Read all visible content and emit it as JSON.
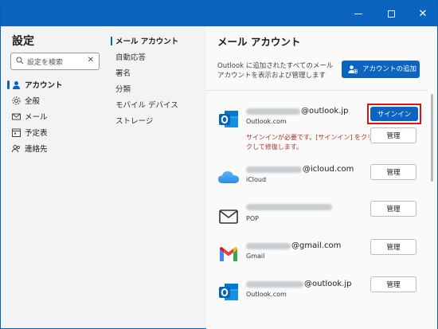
{
  "window": {
    "title_buttons": [
      "minimize",
      "maximize",
      "close"
    ]
  },
  "left": {
    "title": "設定",
    "search_placeholder": "設定を検索",
    "items": [
      {
        "label": "アカウント",
        "icon": "person-icon",
        "selected": true
      },
      {
        "label": "全般",
        "icon": "gear-icon",
        "selected": false
      },
      {
        "label": "メール",
        "icon": "mail-icon",
        "selected": false
      },
      {
        "label": "予定表",
        "icon": "calendar-icon",
        "selected": false
      },
      {
        "label": "連絡先",
        "icon": "people-icon",
        "selected": false
      }
    ]
  },
  "middle": {
    "items": [
      {
        "label": "メール アカウント",
        "selected": true
      },
      {
        "label": "自動応答",
        "selected": false
      },
      {
        "label": "署名",
        "selected": false
      },
      {
        "label": "分類",
        "selected": false
      },
      {
        "label": "モバイル デバイス",
        "selected": false
      },
      {
        "label": "ストレージ",
        "selected": false
      }
    ]
  },
  "right": {
    "title": "メール アカウント",
    "description": "Outlook に追加されたすべてのメール アカウントを表示および管理します",
    "add_account_label": "アカウントの追加",
    "sign_in_label": "サインイン",
    "manage_label": "管理",
    "error_text": "サインインが必要です。[サインイン] をクリックして修復します。",
    "accounts": [
      {
        "domain": "@outlook.jp",
        "provider": "Outlook.com",
        "logo": "outlook-logo"
      },
      {
        "domain": "@icloud.com",
        "provider": "iCloud",
        "logo": "icloud-logo"
      },
      {
        "domain": "",
        "provider": "POP",
        "logo": "mail-envelope-logo"
      },
      {
        "domain": "@gmail.com",
        "provider": "Gmail",
        "logo": "gmail-logo"
      },
      {
        "domain": "@outlook.jp",
        "provider": "Outlook.com",
        "logo": "outlook-logo"
      }
    ]
  },
  "colors": {
    "accent": "#0a64c0",
    "error": "#b0322d",
    "highlight": "#d8141b"
  }
}
